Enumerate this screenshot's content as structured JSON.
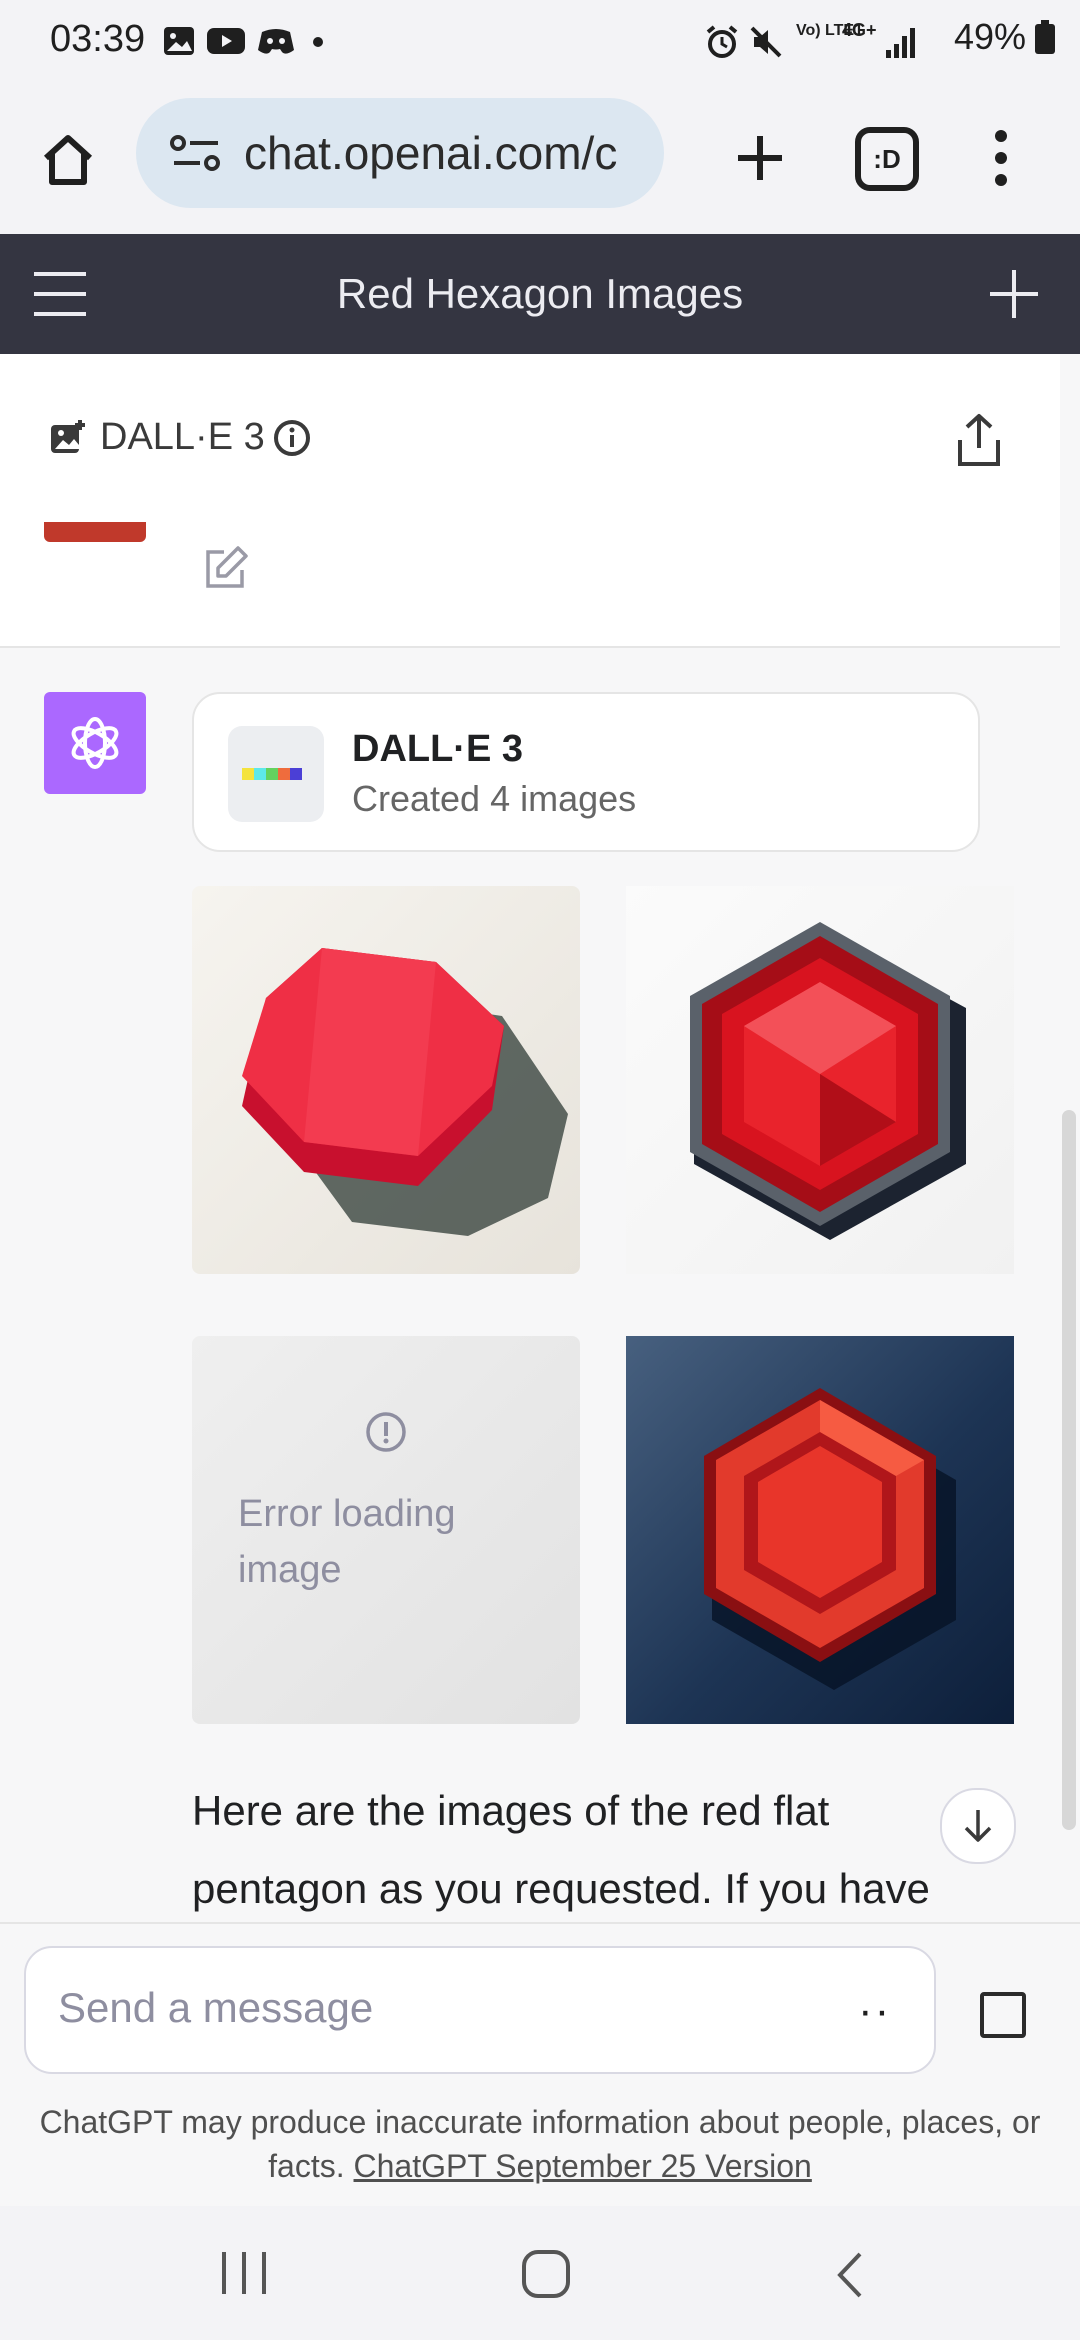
{
  "status_bar": {
    "time": "03:39",
    "battery": "49%",
    "network": "4G+",
    "volte": "Vo) LTE1",
    "icons": [
      "gallery-icon",
      "youtube-icon",
      "discord-icon",
      "dot-icon",
      "alarm-icon",
      "mute-icon",
      "signal-icon",
      "battery-icon"
    ]
  },
  "browser": {
    "url": "chat.openai.com/c",
    "tabs_count": ":D"
  },
  "chat": {
    "title": "Red Hexagon Images"
  },
  "model_bar": {
    "label": "DALL·E 3"
  },
  "assistant": {
    "tool_card": {
      "title": "DALL·E 3",
      "subtitle": "Created 4 images"
    },
    "error_text": "Error loading image",
    "message": "Here are the images of the red flat pentagon as you requested. If you have"
  },
  "composer": {
    "placeholder": "Send a message",
    "mic_label": "··"
  },
  "disclaimer": {
    "text": "ChatGPT may produce inaccurate information about people, places, or facts.",
    "link": "ChatGPT September 25 Version"
  },
  "colors": {
    "header_bg": "#343541",
    "assistant_avatar": "#ab68ff",
    "user_avatar": "#c0392b",
    "url_bar": "#dce7f1"
  }
}
